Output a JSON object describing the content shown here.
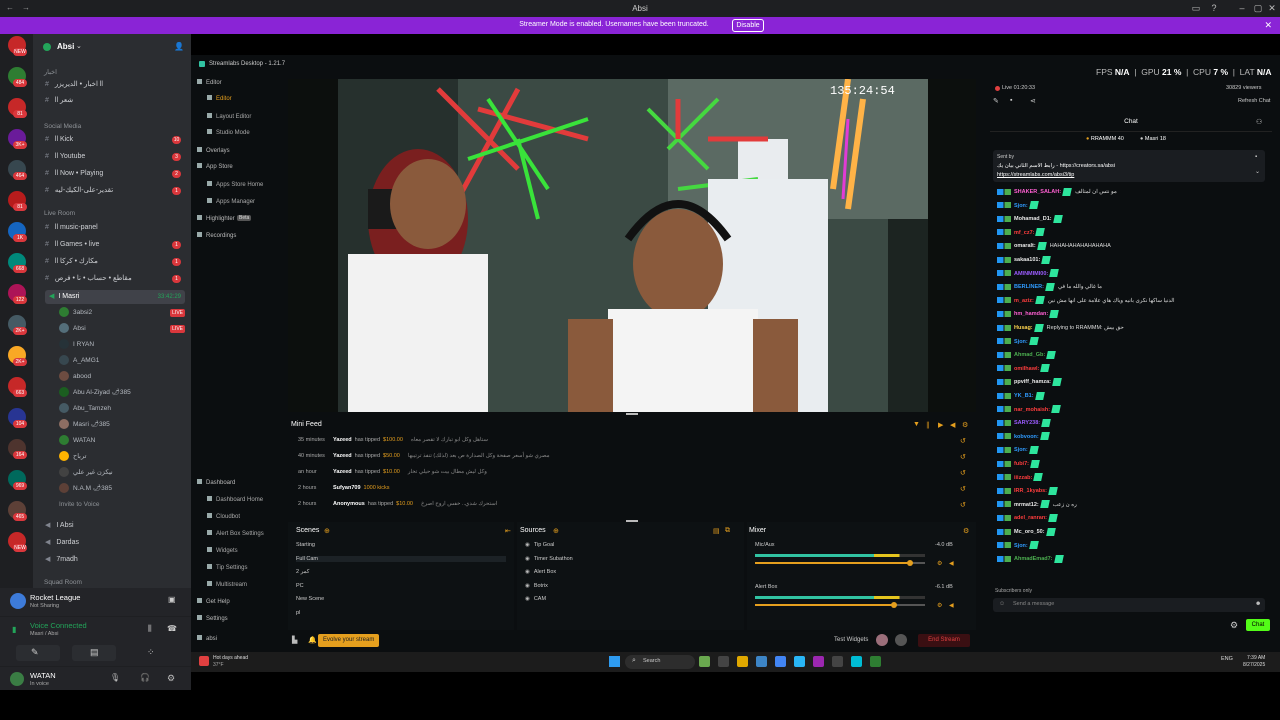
{
  "window": {
    "title": "Absi"
  },
  "banner": {
    "message": "Streamer Mode is enabled. Usernames have been truncated.",
    "disable_label": "Disable"
  },
  "server_rail": {
    "badges": [
      "NEW",
      "484",
      "81",
      "3K+",
      "464",
      "81",
      "1K",
      "668",
      "122",
      "2K+",
      "2K+",
      "663",
      "104",
      "164",
      "969",
      "465",
      "NEW"
    ]
  },
  "channels": {
    "server_name": "Absi",
    "top_category": "اخبار",
    "top_channels": [
      "اخبار • الديريزر ll",
      "ll شعر"
    ],
    "social_category": "Social Media",
    "social_channels": [
      {
        "name": "ll Kick",
        "count": "10"
      },
      {
        "name": "ll Youtube",
        "count": "3"
      },
      {
        "name": "ll Now • Playing",
        "count": "2"
      },
      {
        "name": "تقدير-على-الكيك-ليه",
        "count": "1"
      }
    ],
    "live_category": "Live Room",
    "live_channels": [
      {
        "name": "ll music-panel",
        "count": ""
      },
      {
        "name": "ll Games • live",
        "count": "1"
      },
      {
        "name": "ll مكارك • كركا",
        "count": "1"
      },
      {
        "name": "مقاطع • حساب • نا • فرص",
        "count": "1"
      }
    ],
    "voice_channel": "I Masri",
    "voice_time": "33:42:29",
    "voice_users": [
      {
        "name": "3absi2",
        "live": "LIVE"
      },
      {
        "name": "Absi",
        "live": "LIVE"
      },
      {
        "name": "I RYAN",
        "live": ""
      },
      {
        "name": "A_AMG1",
        "live": ""
      },
      {
        "name": "abood",
        "live": ""
      },
      {
        "name": "Abu Al-Ziyad 🌶385",
        "live": ""
      },
      {
        "name": "Abu_Tamzeh",
        "live": ""
      },
      {
        "name": "Masri 🌶385",
        "live": ""
      },
      {
        "name": "WATAN",
        "live": ""
      },
      {
        "name": "ترباح",
        "live": ""
      },
      {
        "name": "نيكزن غير علي",
        "live": ""
      },
      {
        "name": "N.A.M 🌶385",
        "live": ""
      }
    ],
    "invite_label": "Invite to Voice",
    "extra_voice": [
      "I Absi",
      "Dardas",
      "7madh"
    ],
    "squad_label": "Squad Room"
  },
  "activity": {
    "game": "Rocket League",
    "status": "Not Sharing"
  },
  "voice_connected": {
    "label": "Voice Connected",
    "sub": "Masri / Absi"
  },
  "current_user": {
    "name": "WATAN",
    "status": "In voice"
  },
  "streamlabs": {
    "title": "Streamlabs Desktop - 1.21.7",
    "nav": [
      {
        "label": "Editor",
        "sub": false
      },
      {
        "label": "Editor",
        "sub": true
      },
      {
        "label": "Layout Editor",
        "sub": true
      },
      {
        "label": "Studio Mode",
        "sub": true
      },
      {
        "label": "Overlays",
        "sub": false
      },
      {
        "label": "App Store",
        "sub": false
      },
      {
        "label": "Apps Store Home",
        "sub": true
      },
      {
        "label": "Apps Manager",
        "sub": true
      },
      {
        "label": "Highlighter",
        "sub": false
      },
      {
        "label": "Recordings",
        "sub": false
      }
    ],
    "nav_lower": [
      {
        "label": "Dashboard",
        "sub": false
      },
      {
        "label": "Dashboard Home",
        "sub": true
      },
      {
        "label": "Cloudbot",
        "sub": true
      },
      {
        "label": "Alert Box Settings",
        "sub": true
      },
      {
        "label": "Widgets",
        "sub": true
      },
      {
        "label": "Tip Settings",
        "sub": true
      },
      {
        "label": "Multistream",
        "sub": true
      },
      {
        "label": "Get Help",
        "sub": false
      },
      {
        "label": "Settings",
        "sub": false
      },
      {
        "label": "absi",
        "sub": false
      }
    ],
    "beta_label": "Beta",
    "timer": "135:24:54",
    "minifeed_title": "Mini Feed",
    "feed": [
      {
        "time": "35 minutes",
        "user": "Yazeed",
        "action": "has tipped",
        "amount": "$100.00",
        "message": "ستاهل وكل ابو تبارك لا تقصر معاه"
      },
      {
        "time": "40 minutes",
        "user": "Yazeed",
        "action": "has tipped",
        "amount": "$50.00",
        "message": "مصري شو أسعر صفحة وكل الصدارة ص بعد (لذلك) تنفذ ترتيبها"
      },
      {
        "time": "an hour",
        "user": "Yazeed",
        "action": "has tipped",
        "amount": "$10.00",
        "message": "وكل ليش مطال بيت شو حيلي تخار"
      },
      {
        "time": "2 hours",
        "user": "Sufyan709",
        "action": "",
        "amount": "1000 kicks",
        "message": ""
      },
      {
        "time": "2 hours",
        "user": "Anonymous",
        "action": "has tipped",
        "amount": "$10.00",
        "message": "استحرك شدي.. خفس اروح اصرخ"
      }
    ],
    "scenes_title": "Scenes",
    "scenes": [
      "Starting",
      "Full Cam",
      "كمر 2",
      "PC",
      "New Scene",
      "pl"
    ],
    "sources_title": "Sources",
    "sources": [
      "Tip Goal",
      "Timer Subathon",
      "Alert Box",
      "Botrix",
      "CAM"
    ],
    "mixer_title": "Mixer",
    "mixer": [
      {
        "name": "Mic/Aux",
        "db": "-4.0 dB",
        "level": 0.91
      },
      {
        "name": "Alert Box",
        "db": "-6.1 dB",
        "level": 0.82
      }
    ],
    "evolve_label": "Evolve your stream",
    "test_widgets_label": "Test Widgets",
    "go_live_label": "End Stream"
  },
  "performance": {
    "fps_label": "FPS",
    "fps": "N/A",
    "gpu_label": "GPU",
    "gpu": "21 %",
    "cpu_label": "CPU",
    "cpu": "7 %",
    "lat_label": "LAT",
    "lat": "N/A"
  },
  "chat": {
    "live_time": "Live 01:20:33",
    "viewers": "30829 viewers",
    "refresh_label": "Refresh Chat",
    "title": "Chat",
    "pinned_top": [
      "RRAMMM 40",
      "Masri 18"
    ],
    "pinned_sender": "Sent by",
    "pinned_text": "رابط الاسم الثاني بيان يك - https://creators.sa/absi",
    "pinned_link": "https://streamlabs.com/absi3/tip",
    "lines": [
      {
        "name": "SHAKER_SALAH:",
        "color": "#ff5fd2",
        "text": "مو نتس ان لمتالف"
      },
      {
        "name": "Sjon:",
        "color": "#2f9bff",
        "text": ""
      },
      {
        "name": "Mohamad_D1:",
        "color": "#e8e8e8",
        "text": ""
      },
      {
        "name": "mf_cz7:",
        "color": "#ff3d3d",
        "text": ""
      },
      {
        "name": "omaralt:",
        "color": "#e8e8e8",
        "text": "HAHAHAHAHAHAHAHA"
      },
      {
        "name": "sakaa101:",
        "color": "#e8e8e8",
        "text": ""
      },
      {
        "name": "AMINMIMI00:",
        "color": "#9b5cff",
        "text": ""
      },
      {
        "name": "BERLINER:",
        "color": "#2f9bff",
        "text": "ما غالي والله ما في"
      },
      {
        "name": "m_aziz:",
        "color": "#ff3d3d",
        "text": "الدنيا ساكها نكرى بانيه وياك هاي علامة على انها مش نين"
      },
      {
        "name": "hm_hamdan:",
        "color": "#ff5fd2",
        "text": ""
      },
      {
        "name": "Husag:",
        "color": "#ffd54f",
        "text": "Replying to RRAMMM: حق بيش"
      },
      {
        "name": "Sjon:",
        "color": "#2f9bff",
        "text": ""
      },
      {
        "name": "Ahmad_Gb:",
        "color": "#4caf50",
        "text": ""
      },
      {
        "name": "omilhawl:",
        "color": "#ff3d3d",
        "text": ""
      },
      {
        "name": "ppviff_hamza:",
        "color": "#e8e8e8",
        "text": ""
      },
      {
        "name": "YK_B1:",
        "color": "#2f9bff",
        "text": ""
      },
      {
        "name": "nar_mohaish:",
        "color": "#ff3d3d",
        "text": ""
      },
      {
        "name": "SARY238:",
        "color": "#9b5cff",
        "text": ""
      },
      {
        "name": "kobvoon:",
        "color": "#2f9bff",
        "text": ""
      },
      {
        "name": "Sjon:",
        "color": "#2f9bff",
        "text": ""
      },
      {
        "name": "fubi7:",
        "color": "#ff3d3d",
        "text": ""
      },
      {
        "name": "iiizzab:",
        "color": "#ff3d3d",
        "text": ""
      },
      {
        "name": "IRR_1kyabs:",
        "color": "#ff3d3d",
        "text": ""
      },
      {
        "name": "mrmat12:",
        "color": "#e8e8e8",
        "text": "ره ن زعب"
      },
      {
        "name": "adel_ranran:",
        "color": "#ff3d3d",
        "text": ""
      },
      {
        "name": "Mc_oro_50:",
        "color": "#e8e8e8",
        "text": ""
      },
      {
        "name": "Sjon:",
        "color": "#2f9bff",
        "text": ""
      },
      {
        "name": "AhmadEmad7:",
        "color": "#4caf50",
        "text": ""
      }
    ],
    "subscribers_only": "Subscribers only",
    "input_placeholder": "Send a message",
    "chat_button": "Chat"
  },
  "taskbar": {
    "weather_line1": "Hot days ahead",
    "weather_line2": "37°F",
    "search_placeholder": "Search",
    "lang": "ENG",
    "time": "7:39 AM",
    "date": "8/27/2025"
  },
  "colors": {
    "accent": "#8a24d6",
    "kick_green": "#53fc18",
    "live_red": "#da373c",
    "gold": "#e59f1e"
  }
}
